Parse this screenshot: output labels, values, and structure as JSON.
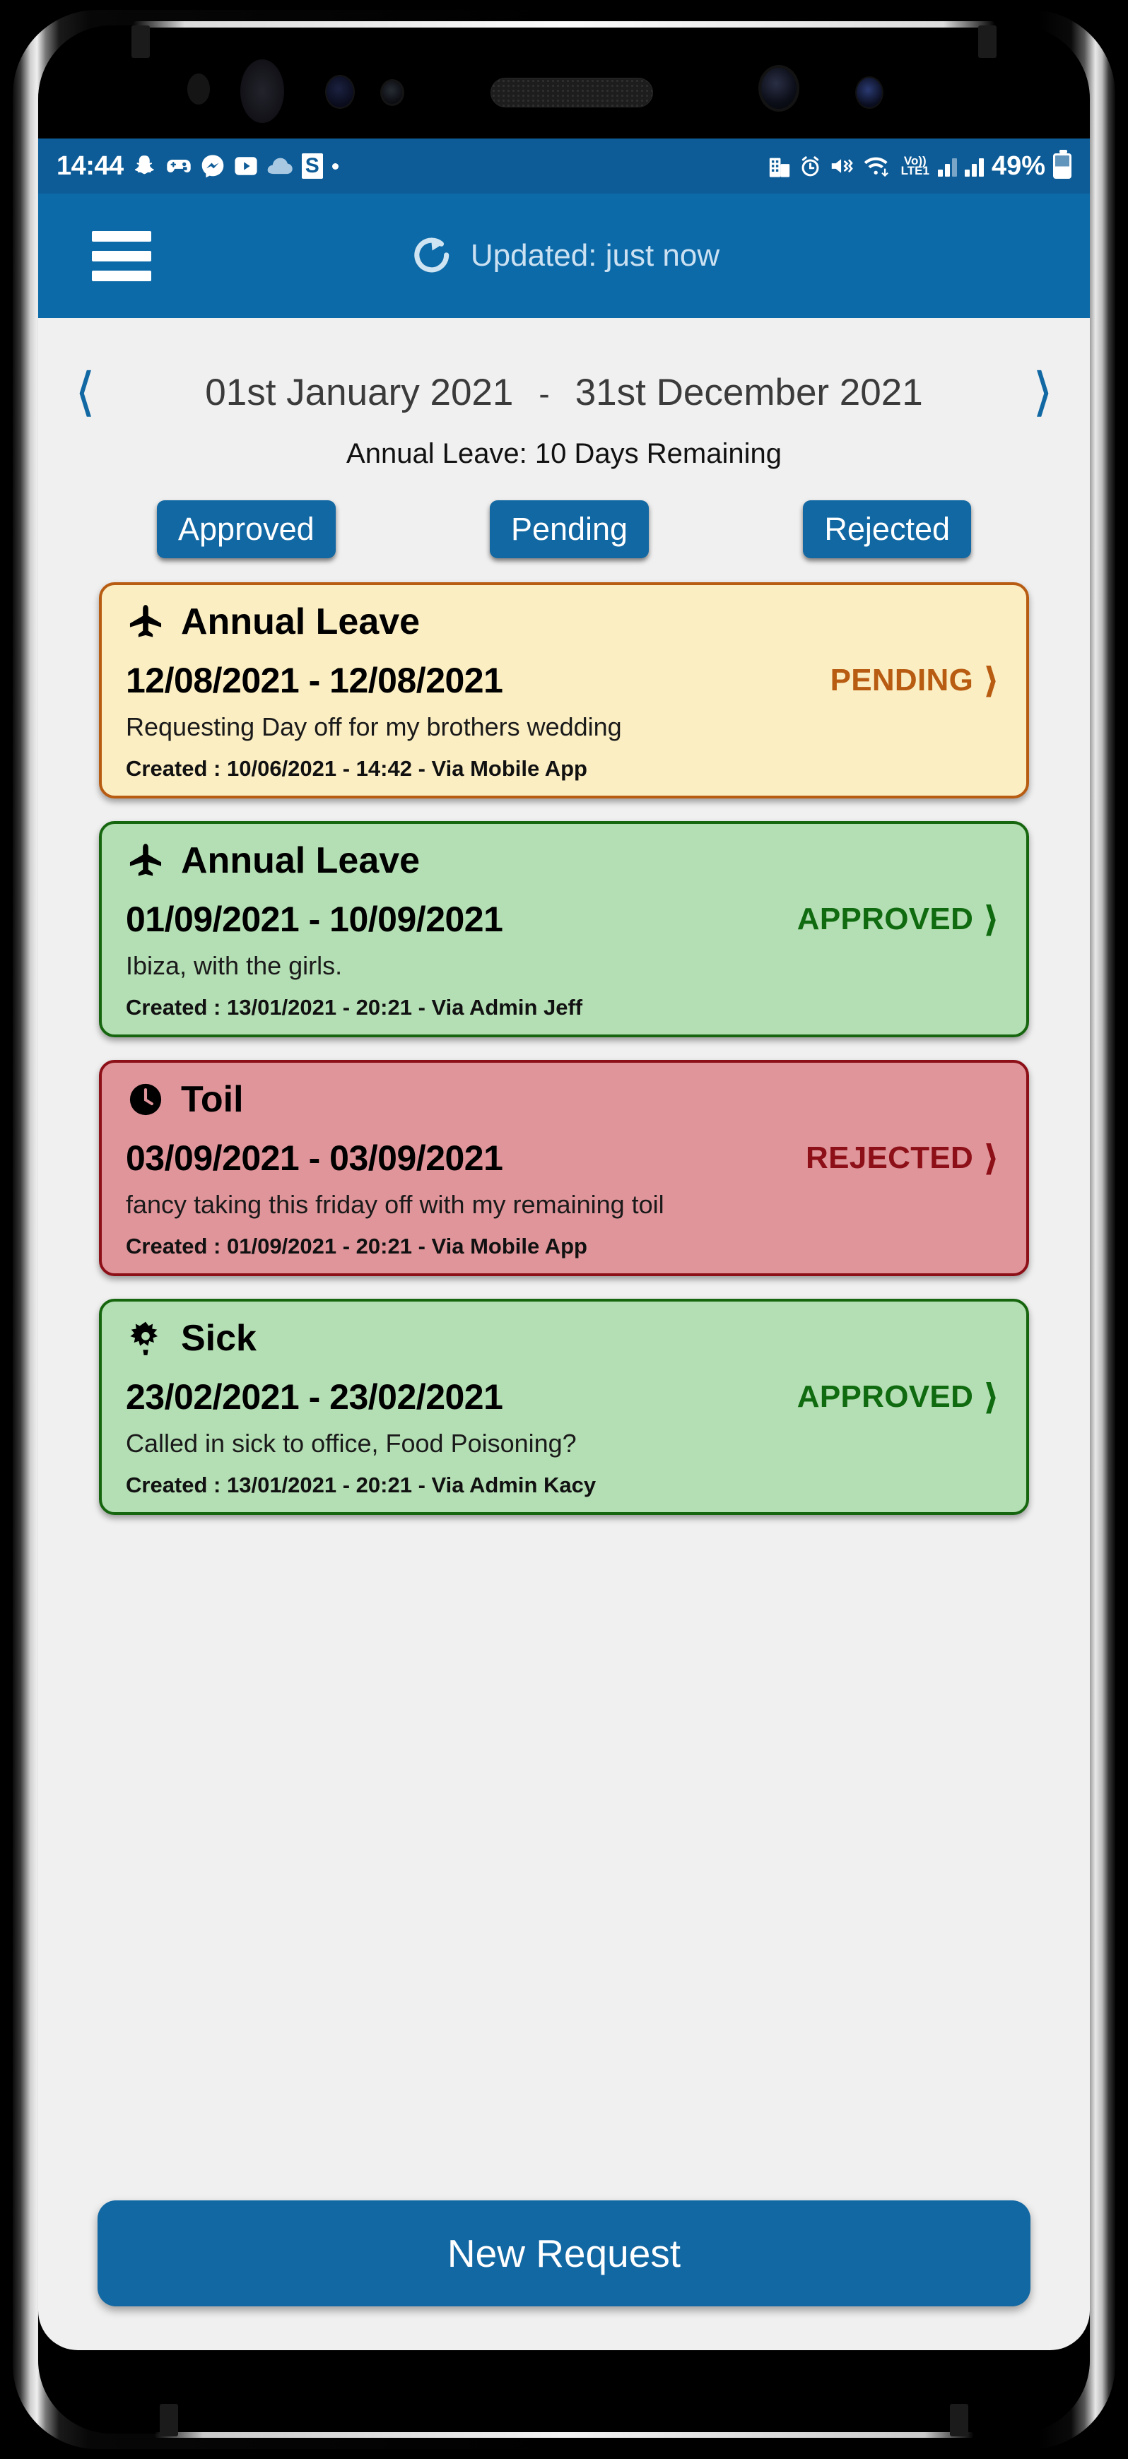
{
  "status_bar": {
    "time": "14:44",
    "left_icons": [
      "snapchat-icon",
      "game-controller-icon",
      "messenger-icon",
      "youtube-icon",
      "cloud-icon",
      "s-badge-icon",
      "dot-icon"
    ],
    "right_icons": [
      "building-icon",
      "alarm-clock-icon",
      "mute-vibrate-icon",
      "wifi-icon"
    ],
    "network_label_top": "Vo))",
    "network_label_bottom": "LTE1",
    "battery_percent": "49%"
  },
  "app_bar": {
    "menu_icon": "hamburger-menu-icon",
    "refresh_icon": "refresh-icon",
    "updated_text": "Updated: just now"
  },
  "date_nav": {
    "prev_icon": "chevron-left-icon",
    "next_icon": "chevron-right-icon",
    "start_date": "01st January 2021",
    "separator": "-",
    "end_date": "31st December 2021"
  },
  "balance": {
    "text": "Annual Leave:  10 Days Remaining"
  },
  "filters": [
    {
      "label": "Approved",
      "name": "filter-approved"
    },
    {
      "label": "Pending",
      "name": "filter-pending"
    },
    {
      "label": "Rejected",
      "name": "filter-rejected"
    }
  ],
  "requests": [
    {
      "type": "Annual Leave",
      "icon": "airplane-icon",
      "dates": "12/08/2021 - 12/08/2021",
      "status": "PENDING",
      "status_class": "pending",
      "reason": "Requesting Day off for my brothers wedding",
      "created": "Created : 10/06/2021 - 14:42 - Via Mobile App",
      "arrow_icon": "chevron-right-icon"
    },
    {
      "type": "Annual Leave",
      "icon": "airplane-icon",
      "dates": "01/09/2021 - 10/09/2021",
      "status": "APPROVED",
      "status_class": "approved",
      "reason": "Ibiza, with the girls.",
      "created": "Created : 13/01/2021 - 20:21 - Via Admin Jeff",
      "arrow_icon": "chevron-right-icon"
    },
    {
      "type": "Toil",
      "icon": "clock-icon",
      "dates": "03/09/2021 - 03/09/2021",
      "status": "REJECTED",
      "status_class": "rejected",
      "reason": "fancy taking this friday off with my remaining toil",
      "created": "Created : 01/09/2021 - 20:21 - Via Mobile App",
      "arrow_icon": "chevron-right-icon"
    },
    {
      "type": "Sick",
      "icon": "virus-icon",
      "dates": "23/02/2021 - 23/02/2021",
      "status": "APPROVED",
      "status_class": "approved",
      "reason": "Called in sick to office, Food Poisoning?",
      "created": "Created : 13/01/2021 - 20:21 - Via Admin Kacy",
      "arrow_icon": "chevron-right-icon"
    }
  ],
  "new_request_button": {
    "label": "New Request"
  },
  "colors": {
    "status_bar": "#0d5c97",
    "app_bar": "#0d6aa8",
    "accent": "#1268a3",
    "page_bg": "#f0f0f0",
    "pending_bg": "#fbeec3",
    "pending_border": "#b85c12",
    "approved_bg": "#b4dfb4",
    "approved_border": "#16660f",
    "rejected_bg": "#e0959a",
    "rejected_border": "#8d0f17"
  }
}
